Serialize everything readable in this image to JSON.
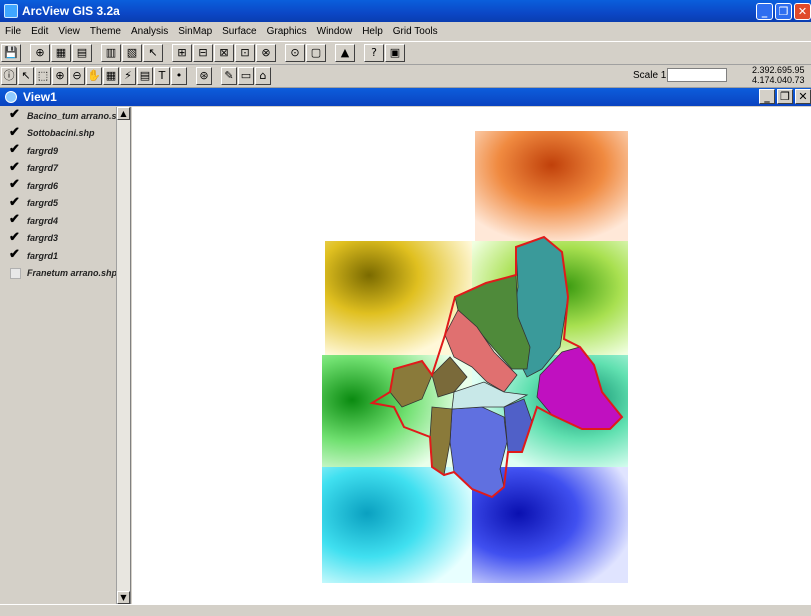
{
  "app": {
    "title": "ArcView GIS 3.2a"
  },
  "menu": [
    "File",
    "Edit",
    "View",
    "Theme",
    "Analysis",
    "SinMap",
    "Surface",
    "Graphics",
    "Window",
    "Help",
    "Grid Tools"
  ],
  "toolbar1": [
    "💾",
    "⊕",
    "▦",
    "▤",
    "▥",
    "▧",
    "↖",
    "⊞",
    "⊟",
    "⊠",
    "⊡",
    "⊗",
    "⊙",
    "▢",
    "▲",
    "?",
    "▣"
  ],
  "toolbar2": [
    "ⓘ",
    "↖",
    "⬚",
    "⊕",
    "⊖",
    "✋",
    "▦",
    "⚡",
    "▤",
    "T",
    "•",
    "⊛",
    "✎",
    "▭",
    "⌂"
  ],
  "scale": {
    "label": "Scale 1:",
    "value": ""
  },
  "coords": {
    "x": "2.392.695.95",
    "y": "4.174.040.73"
  },
  "view": {
    "title": "View1"
  },
  "toc": [
    {
      "label": "Bacino_tum arrano.s...",
      "checked": true
    },
    {
      "label": "Sottobacini.shp",
      "checked": true
    },
    {
      "label": "fargrd9",
      "checked": true
    },
    {
      "label": "fargrd7",
      "checked": true
    },
    {
      "label": "fargrd6",
      "checked": true
    },
    {
      "label": "fargrd5",
      "checked": true
    },
    {
      "label": "fargrd4",
      "checked": true
    },
    {
      "label": "fargrd3",
      "checked": true
    },
    {
      "label": "fargrd1",
      "checked": true
    },
    {
      "label": "Franetum arrano.shp",
      "checked": false
    }
  ],
  "colors": {
    "basin_outline": "#e01a1a",
    "subbasins": [
      "#3a9a9a",
      "#4f8a3a",
      "#e07070",
      "#c010c0",
      "#6070e0",
      "#8a7a3a",
      "#5060c8",
      "#c8e8e8",
      "#7a6a3a"
    ]
  }
}
